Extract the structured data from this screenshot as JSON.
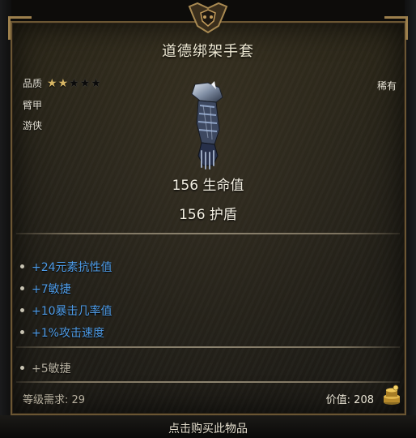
{
  "item": {
    "name": "道德绑架手套",
    "quality_label": "品质",
    "quality_stars_filled": 2,
    "quality_stars_total": 5,
    "slot": "臂甲",
    "class": "游侠",
    "rarity": "稀有",
    "icon": "gauntlet-icon"
  },
  "base_stats": {
    "health": "156 生命值",
    "shield": "156 护盾"
  },
  "modifiers": [
    "+24元素抗性值",
    "+7敏捷",
    "+10暴击几率值",
    "+1%攻击速度"
  ],
  "extra_modifiers": [
    "+5敏捷"
  ],
  "footer": {
    "level_requirement": "等级需求: 29",
    "price": "价值: 208",
    "price_icon": "coin-stack-icon",
    "buy_action": "点击购买此物品"
  },
  "colors": {
    "modifier_blue": "#4e9be6",
    "star_gold": "#d8b765",
    "frame_gold": "#6b5633"
  }
}
